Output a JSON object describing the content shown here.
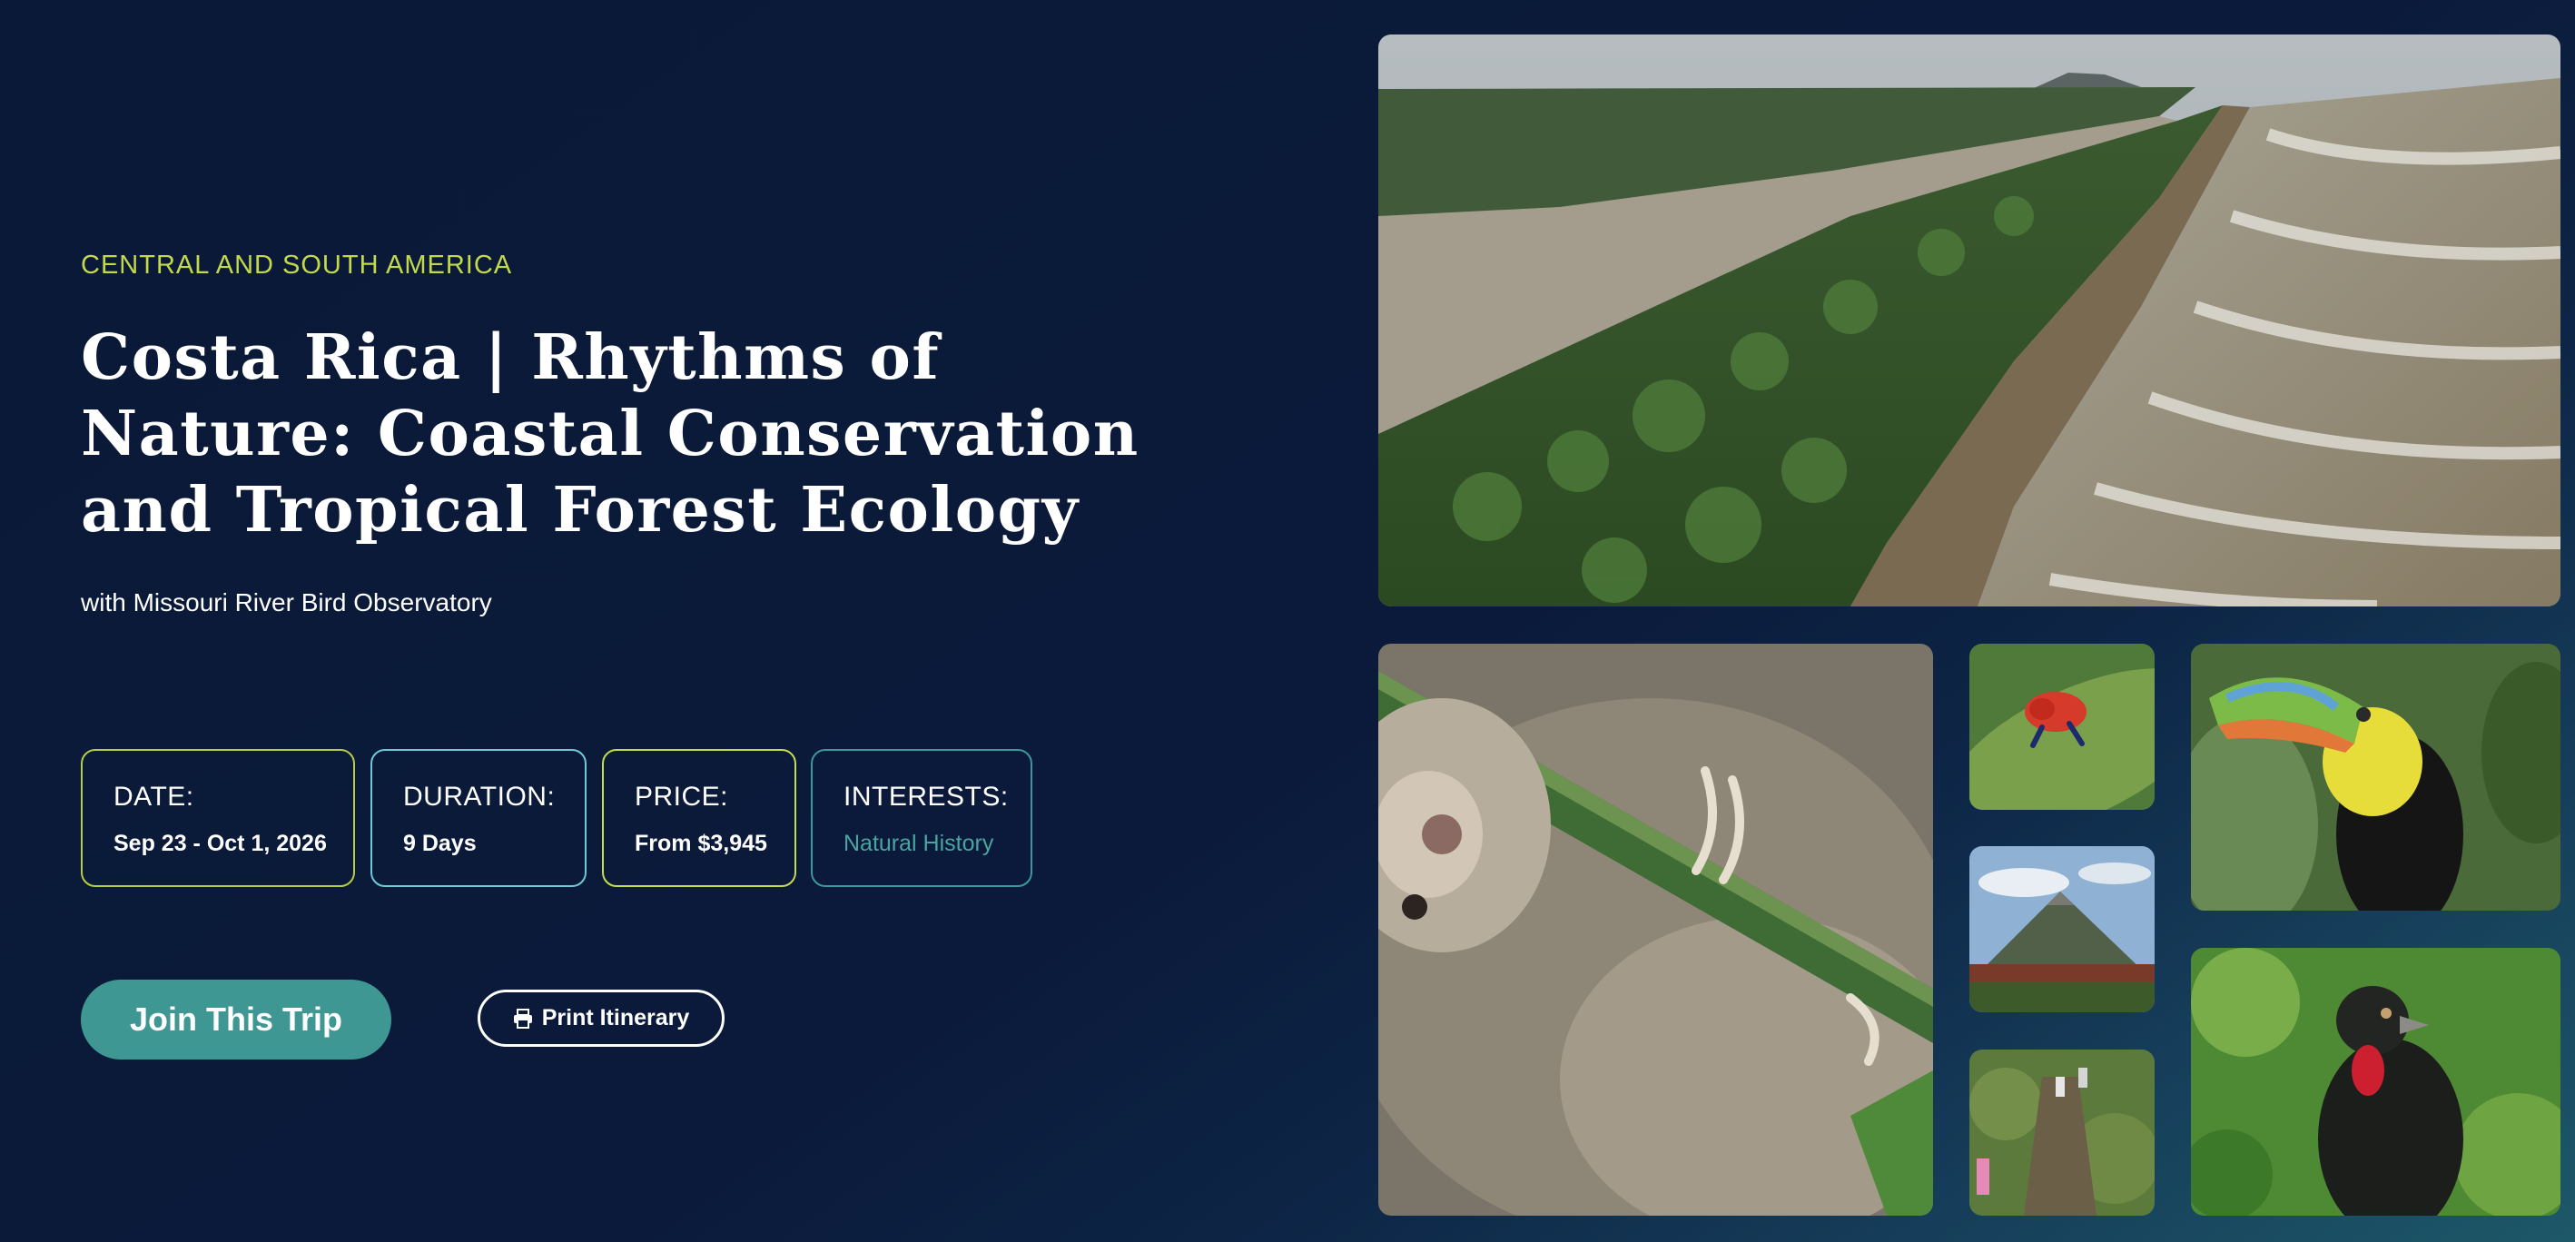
{
  "trip": {
    "region": "CENTRAL AND SOUTH AMERICA",
    "title": "Costa Rica | Rhythms of Nature: Coastal Conservation and Tropical Forest Ecology",
    "partner": "with Missouri River Bird Observatory"
  },
  "details": {
    "date_label": "DATE:",
    "date_value": "Sep 23 - Oct 1, 2026",
    "duration_label": "DURATION:",
    "duration_value": "9 Days",
    "price_label": "PRICE:",
    "price_value": "From $3,945",
    "interests_label": "INTERESTS:",
    "interests_value": "Natural History"
  },
  "actions": {
    "join_label": "Join This Trip",
    "print_label": "Print Itinerary",
    "print_icon": "printer-icon"
  },
  "gallery": {
    "photos": [
      {
        "subject": "aerial-coastline-photo"
      },
      {
        "subject": "sloth-photo"
      },
      {
        "subject": "poison-dart-frog-photo"
      },
      {
        "subject": "arenal-volcano-photo"
      },
      {
        "subject": "forest-hikers-photo"
      },
      {
        "subject": "toucan-photo"
      },
      {
        "subject": "crested-guan-photo"
      }
    ]
  },
  "colors": {
    "background": "#0b1a3a",
    "eyebrow": "#c3d94a",
    "accent_teal": "#3e9792",
    "interests_text": "#4aa5a0"
  }
}
